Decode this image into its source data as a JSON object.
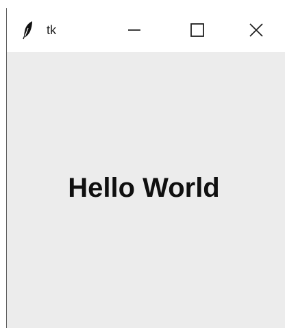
{
  "window": {
    "title": "tk"
  },
  "titlebar": {
    "buttons": [
      {
        "name": "minimize"
      },
      {
        "name": "maximize"
      },
      {
        "name": "close"
      }
    ]
  },
  "client": {
    "label_text": "Hello World"
  },
  "colors": {
    "window_bg": "#ececec",
    "titlebar_bg": "#ffffff",
    "text": "#101010"
  },
  "icons": {
    "app_icon": "feather-icon",
    "minimize_icon": "minimize-icon",
    "maximize_icon": "maximize-icon",
    "close_icon": "close-icon"
  }
}
